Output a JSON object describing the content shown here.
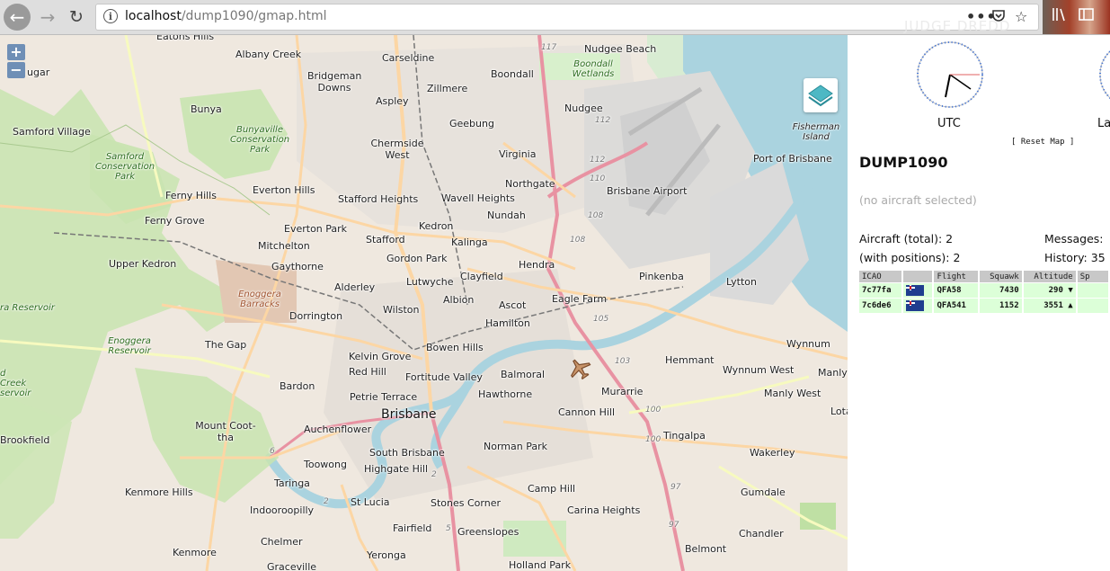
{
  "browser": {
    "url_host": "localhost",
    "url_path": "/dump1090/gmap.html",
    "theme_text": "JUDGE DREDD"
  },
  "map": {
    "zoom_in": "+",
    "zoom_out": "−",
    "suburbs": [
      {
        "name": "Eatons Hills"
      },
      {
        "name": "Albany Creek"
      },
      {
        "name": "Carseldine"
      },
      {
        "name": "Nudgee Beach"
      },
      {
        "name": "Bridgeman Downs"
      },
      {
        "name": "Boondall"
      },
      {
        "name": "Zillmere"
      },
      {
        "name": "Bunya"
      },
      {
        "name": "Aspley"
      },
      {
        "name": "Nudgee"
      },
      {
        "name": "Geebung"
      },
      {
        "name": "Samford Village"
      },
      {
        "name": "Chermside West"
      },
      {
        "name": "Virginia"
      },
      {
        "name": "Northgate"
      },
      {
        "name": "Everton Hills"
      },
      {
        "name": "Brisbane Airport"
      },
      {
        "name": "Ferny Hills"
      },
      {
        "name": "Stafford Heights"
      },
      {
        "name": "Wavell Heights"
      },
      {
        "name": "Nundah"
      },
      {
        "name": "Ferny Grove"
      },
      {
        "name": "Kedron"
      },
      {
        "name": "Everton Park"
      },
      {
        "name": "Stafford"
      },
      {
        "name": "Mitchelton"
      },
      {
        "name": "Kalinga"
      },
      {
        "name": "Upper Kedron"
      },
      {
        "name": "Gordon Park"
      },
      {
        "name": "Gaythorne"
      },
      {
        "name": "Hendra"
      },
      {
        "name": "Clayfield"
      },
      {
        "name": "Pinkenba"
      },
      {
        "name": "Lytton"
      },
      {
        "name": "Lutwyche"
      },
      {
        "name": "Alderley"
      },
      {
        "name": "Eagle Farm"
      },
      {
        "name": "Albion"
      },
      {
        "name": "Ascot"
      },
      {
        "name": "Wilston"
      },
      {
        "name": "Dorrington"
      },
      {
        "name": "Hamilton"
      },
      {
        "name": "The Gap"
      },
      {
        "name": "Bowen Hills"
      },
      {
        "name": "Wynnum"
      },
      {
        "name": "Kelvin Grove"
      },
      {
        "name": "Hemmant"
      },
      {
        "name": "Red Hill"
      },
      {
        "name": "Fortitude Valley"
      },
      {
        "name": "Balmoral"
      },
      {
        "name": "Wynnum West"
      },
      {
        "name": "Manly"
      },
      {
        "name": "Bardon"
      },
      {
        "name": "Hawthorne"
      },
      {
        "name": "Murarrie"
      },
      {
        "name": "Manly West"
      },
      {
        "name": "Petrie Terrace"
      },
      {
        "name": "Cannon Hill"
      },
      {
        "name": "Lota"
      },
      {
        "name": "Auchenflower"
      },
      {
        "name": "Tingalpa"
      },
      {
        "name": "Brookfield"
      },
      {
        "name": "Norman Park"
      },
      {
        "name": "South Brisbane"
      },
      {
        "name": "Wakerley"
      },
      {
        "name": "Toowong"
      },
      {
        "name": "Highgate Hill"
      },
      {
        "name": "Taringa"
      },
      {
        "name": "Camp Hill"
      },
      {
        "name": "Kenmore Hills"
      },
      {
        "name": "St Lucia"
      },
      {
        "name": "Stones Corner"
      },
      {
        "name": "Gumdale"
      },
      {
        "name": "Indooroopilly"
      },
      {
        "name": "Carina Heights"
      },
      {
        "name": "Fairfield"
      },
      {
        "name": "Greenslopes"
      },
      {
        "name": "Chandler"
      },
      {
        "name": "Chelmer"
      },
      {
        "name": "Kenmore"
      },
      {
        "name": "Belmont"
      },
      {
        "name": "Yeronga"
      },
      {
        "name": "Graceville"
      },
      {
        "name": "Holland Park"
      },
      {
        "name": "Fisherman Island"
      },
      {
        "name": "Port of Brisbane"
      }
    ],
    "city": "Brisbane",
    "parks": [
      {
        "name": "Bunyaville Conservation Park"
      },
      {
        "name": "Samford Conservation Park"
      },
      {
        "name": "Enoggera Barracks"
      },
      {
        "name": "Enoggera Reservoir"
      },
      {
        "name": "Mount Coot-tha"
      },
      {
        "name": "Boondall Wetlands"
      },
      {
        "name": "ra Reservoir"
      },
      {
        "name": "d Creek servoir"
      }
    ],
    "road_numbers": [
      "117",
      "112",
      "112",
      "110",
      "108",
      "108",
      "105",
      "103",
      "100",
      "100",
      "97",
      "97",
      "2",
      "5",
      "6",
      "2"
    ],
    "partial_labels": [
      {
        "name": "ugar"
      }
    ]
  },
  "panel": {
    "clocks": [
      {
        "label": "UTC"
      },
      {
        "label": "La"
      }
    ],
    "reset_map": "[ Reset Map ]",
    "title": "DUMP1090",
    "no_selection": "(no aircraft selected)",
    "aircraft_total": "Aircraft (total): 2",
    "with_positions": "(with positions): 2",
    "messages": "Messages:",
    "history": "History: 35",
    "table": {
      "headers": [
        "ICAO",
        "",
        "Flight",
        "Squawk",
        "Altitude",
        "Sp"
      ],
      "rows": [
        {
          "icao": "7c77fa",
          "flight": "QFA58",
          "squawk": "7430",
          "altitude": "290 ▼"
        },
        {
          "icao": "7c6de6",
          "flight": "QFA541",
          "squawk": "1152",
          "altitude": "3551 ▲"
        }
      ]
    }
  },
  "colors": {
    "park_green": "#c8e4b0",
    "water": "#aad3df",
    "motorway": "#e892a2",
    "primary_road": "#fcd6a4",
    "row_green": "#dcffd8"
  }
}
